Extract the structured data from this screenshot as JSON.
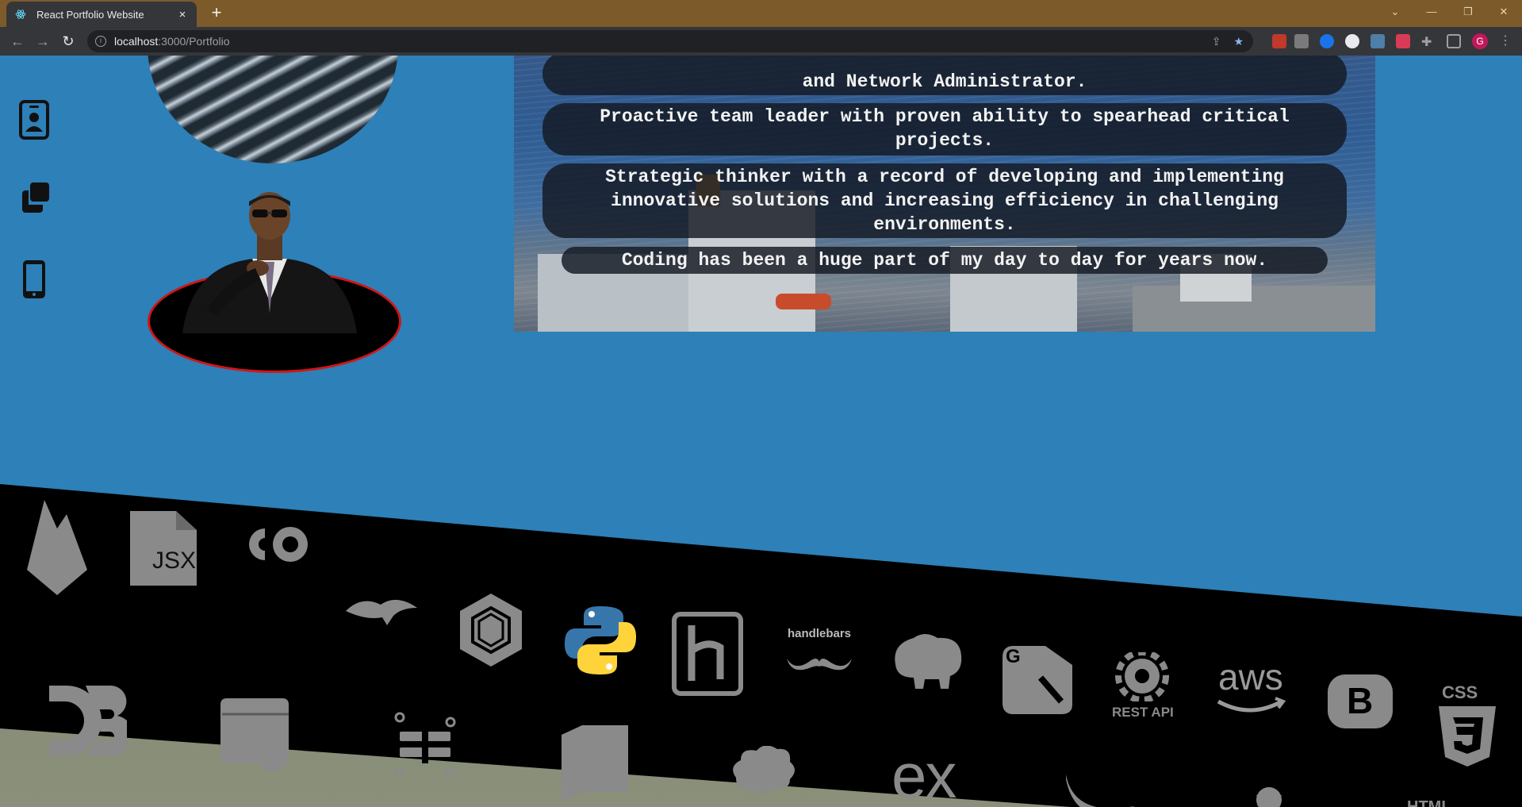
{
  "browser": {
    "tab_title": "React Portfolio Website",
    "tab_close": "×",
    "new_tab": "+",
    "url_host": "localhost",
    "url_path": ":3000/Portfolio",
    "profile_initial": "G"
  },
  "sidebar": {
    "items": [
      {
        "icon": "contact-card-icon"
      },
      {
        "icon": "copy-icon"
      },
      {
        "icon": "phone-icon"
      }
    ]
  },
  "hero": {
    "pills": [
      "and Network Administrator.",
      "Proactive team leader with proven ability to spearhead critical projects.",
      "Strategic thinker with a record of developing and implementing innovative solutions and increasing efficiency in challenging environments.",
      "Coding has been a huge part of my day to day for years now."
    ]
  },
  "tech_icons": {
    "row1": [
      "firebase-icon",
      "jsx-icon",
      "codepen-icon",
      "mongoose-icon",
      "graphql-icon",
      "python-icon",
      "heroku-icon",
      "handlebars-icon",
      "elephant-icon",
      "glitch-icon",
      "rest-api-icon",
      "aws-icon",
      "bootstrap-icon",
      "css3-icon"
    ],
    "row2": [
      "d3-icon",
      "window-icon",
      "workflow-icon",
      "book-icon",
      "cloud-icon",
      "express-icon",
      "jquery-icon",
      "stamp-icon",
      "html5-icon"
    ],
    "labels": {
      "jsx": "JSX",
      "handlebars": "handlebars",
      "rest_api": "REST API",
      "aws": "aws",
      "bootstrap": "B",
      "css": "CSS",
      "css_num": "3",
      "express": "ex",
      "html": "HTML",
      "d3": "D3"
    }
  },
  "colors": {
    "page_bg": "#2d80b8",
    "tab_strip": "#7d5a2a",
    "portrait_ring": "#d01616",
    "python_blue": "#3776ab",
    "python_yellow": "#ffd43b"
  }
}
